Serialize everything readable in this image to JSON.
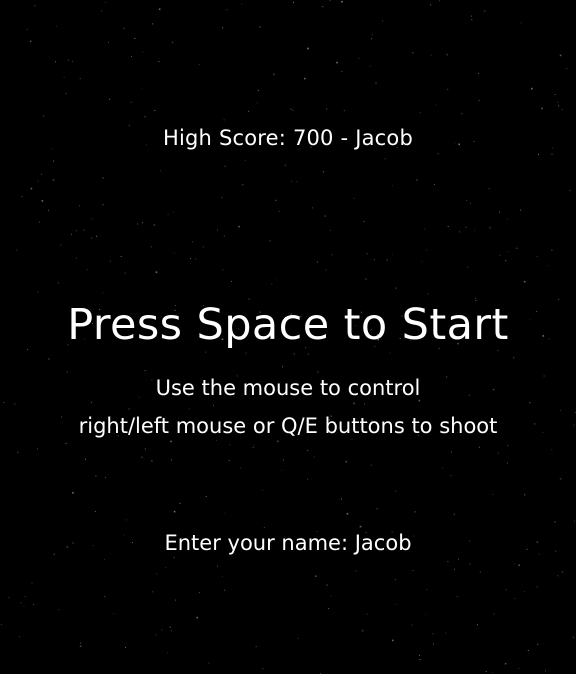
{
  "high_score": {
    "label": "High Score:",
    "value": "700",
    "separator": "-",
    "player": "Jacob"
  },
  "title": "Press Space to Start",
  "instructions": {
    "line1": "Use the mouse to control",
    "line2": "right/left mouse or Q/E buttons to shoot"
  },
  "name_prompt": {
    "label": "Enter your name:",
    "value": "Jacob"
  },
  "colors": {
    "background": "#000000",
    "text": "#ffffff",
    "stars": "#8a8a8a"
  }
}
